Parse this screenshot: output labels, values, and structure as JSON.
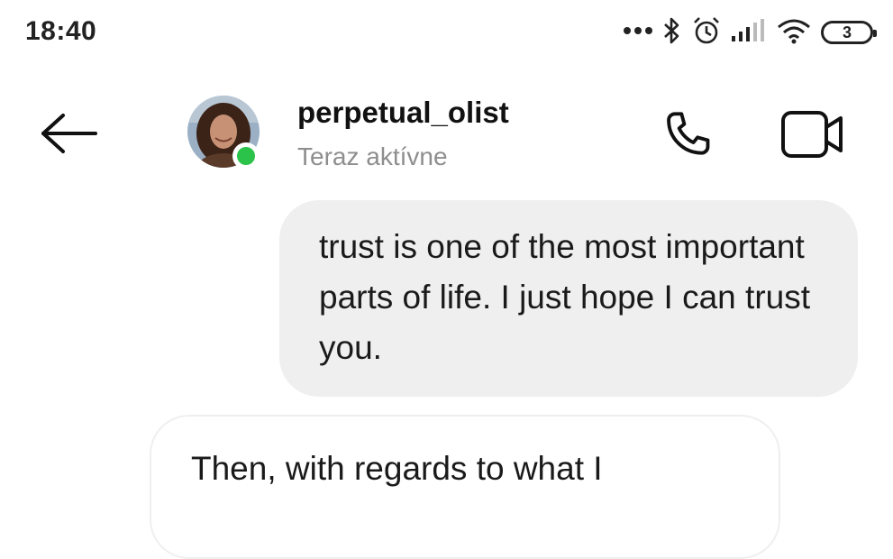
{
  "status_bar": {
    "time": "18:40",
    "battery_level": "3",
    "icons": [
      "more-dots-icon",
      "bluetooth-icon",
      "alarm-icon",
      "signal-icon",
      "wifi-icon",
      "battery-icon"
    ]
  },
  "header": {
    "back_icon": "arrow-left-icon",
    "contact_name": "perpetual_olist",
    "contact_status": "Teraz aktívne",
    "online_color": "#2cc34b",
    "call_icon": "phone-icon",
    "video_icon": "video-camera-icon"
  },
  "messages": [
    {
      "direction": "outgoing",
      "text": "trust is one of the most important parts of life. I just hope I can trust you."
    },
    {
      "direction": "incoming",
      "text": "Then, with regards to what I"
    }
  ],
  "colors": {
    "outgoing_bubble": "#efefef",
    "incoming_bubble_border": "#efefef",
    "status_text": "#8e8e8e"
  }
}
